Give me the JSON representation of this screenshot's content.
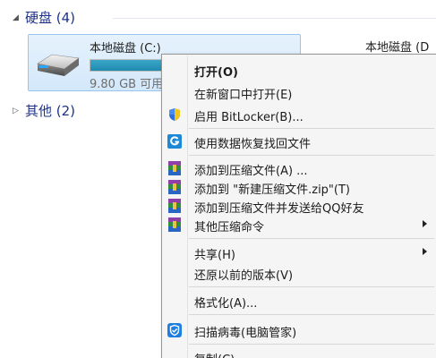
{
  "groups": {
    "disk": {
      "label": "硬盘 (4)"
    },
    "other": {
      "label": "其他 (2)"
    }
  },
  "drives": [
    {
      "name": "本地磁盘 (C:)",
      "free": "9.80 GB 可用",
      "used_fraction": 0.88
    },
    {
      "name": "本地磁盘 (D"
    }
  ],
  "menu": {
    "items": [
      {
        "label": "打开(O)",
        "bold": true,
        "icon": "none"
      },
      {
        "label": "在新窗口中打开(E)",
        "icon": "none"
      },
      {
        "label": "启用 BitLocker(B)...",
        "icon": "uac-shield-icon"
      },
      {
        "label": "使用数据恢复找回文件",
        "icon": "data-recovery-icon"
      },
      {
        "label": "添加到压缩文件(A) ...",
        "icon": "winrar-icon"
      },
      {
        "label": "添加到 \"新建压缩文件.zip\"(T)",
        "icon": "winrar-icon"
      },
      {
        "label": "添加到压缩文件并发送给QQ好友",
        "icon": "winrar-icon"
      },
      {
        "label": "其他压缩命令",
        "icon": "winrar-icon",
        "submenu": true
      },
      {
        "label": "共享(H)",
        "icon": "none",
        "submenu": true
      },
      {
        "label": "还原以前的版本(V)",
        "icon": "none"
      },
      {
        "label": "格式化(A)...",
        "icon": "none"
      },
      {
        "label": "扫描病毒(电脑管家)",
        "icon": "pc-manager-shield-icon"
      },
      {
        "label": "复制(C)",
        "icon": "none"
      }
    ]
  },
  "colors": {
    "group_header": "#1e3287",
    "selection_bg": "#d3e8fb",
    "selection_border": "#98c5ee",
    "usage_bar": "#26a0da"
  }
}
